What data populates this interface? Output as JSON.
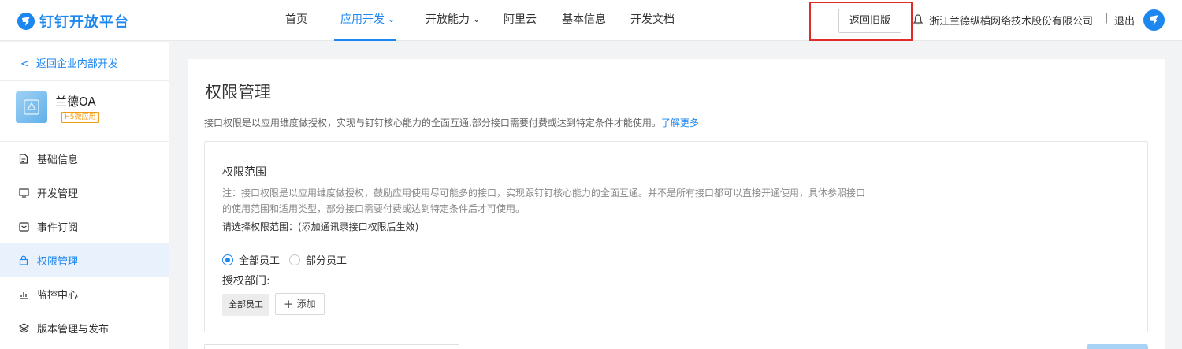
{
  "header": {
    "logo_text": "钉钉开放平台",
    "nav": [
      {
        "label": "首页",
        "active": false,
        "chevron": false
      },
      {
        "label": "应用开发",
        "active": true,
        "chevron": true
      },
      {
        "label": "开放能力",
        "active": false,
        "chevron": true
      },
      {
        "label": "阿里云",
        "active": false,
        "chevron": false
      },
      {
        "label": "基本信息",
        "active": false,
        "chevron": false
      },
      {
        "label": "开发文档",
        "active": false,
        "chevron": false
      }
    ],
    "old_version_button": "返回旧版",
    "company": "浙江兰德纵横网络技术股份有限公司",
    "separator": "|",
    "logout": "退出",
    "brand_color": "#1d87f0",
    "highlight_color": "#e12b2b"
  },
  "sidebar": {
    "back_link": "返回企业内部开发",
    "app": {
      "name": "兰德OA",
      "tag": "H5微应用"
    },
    "items": [
      {
        "label": "基础信息",
        "icon": "document-icon",
        "active": false
      },
      {
        "label": "开发管理",
        "icon": "monitor-icon",
        "active": false
      },
      {
        "label": "事件订阅",
        "icon": "subscribe-icon",
        "active": false
      },
      {
        "label": "权限管理",
        "icon": "lock-icon",
        "active": true
      },
      {
        "label": "监控中心",
        "icon": "bar-chart-icon",
        "active": false
      },
      {
        "label": "版本管理与发布",
        "icon": "layers-icon",
        "active": false
      }
    ]
  },
  "main": {
    "title": "权限管理",
    "description": "接口权限是以应用维度做授权，实现与钉钉核心能力的全面互通,部分接口需要付费或达到特定条件才能使用。",
    "learn_more": "了解更多",
    "scope": {
      "title": "权限范围",
      "note": "注：接口权限是以应用维度做授权，鼓励应用使用尽可能多的接口，实现跟钉钉核心能力的全面互通。并不是所有接口都可以直接开通使用，具体参照接口的使用范围和适用类型，部分接口需要付费或达到特定条件后才可使用。",
      "prompt": "请选择权限范围：(添加通讯录接口权限后生效)",
      "options": [
        {
          "label": "全部员工",
          "checked": true
        },
        {
          "label": "部分员工",
          "checked": false
        }
      ],
      "dept_label": "授权部门:",
      "dept_chip": "全部员工",
      "add_label": "添加"
    }
  }
}
